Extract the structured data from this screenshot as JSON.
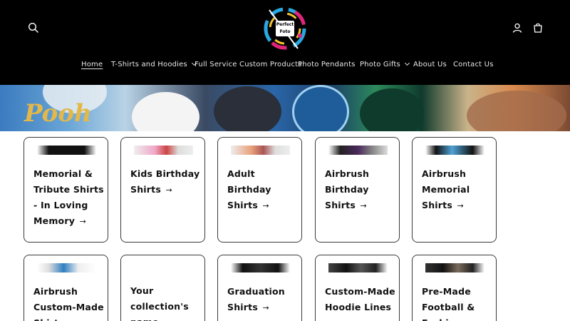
{
  "header": {
    "logo": {
      "line1": "Perfect",
      "line2": "Foto"
    },
    "icons": {
      "search": "search-icon",
      "account": "user-icon",
      "cart": "cart-icon"
    }
  },
  "nav": {
    "items": [
      {
        "label": "Home",
        "active": true,
        "dropdown": false
      },
      {
        "label": "T-Shirts and Hoodies",
        "active": false,
        "dropdown": true
      },
      {
        "label": "Full Service Custom Products",
        "active": false,
        "dropdown": false
      },
      {
        "label": "Photo Pendants",
        "active": false,
        "dropdown": false
      },
      {
        "label": "Photo Gifts",
        "active": false,
        "dropdown": true
      },
      {
        "label": "About Us",
        "active": false,
        "dropdown": false
      },
      {
        "label": "Contact Us",
        "active": false,
        "dropdown": false
      }
    ]
  },
  "banner": {
    "script_text": "Pooh"
  },
  "collections": {
    "row1": [
      {
        "title": "Memorial & Tribute Shirts - In Loving Memory",
        "arrow": "→"
      },
      {
        "title": "Kids Birthday Shirts",
        "arrow": "→"
      },
      {
        "title": "Adult Birthday Shirts",
        "arrow": "→"
      },
      {
        "title": "Airbrush Birthday Shirts",
        "arrow": "→"
      },
      {
        "title": "Airbrush Memorial Shirts",
        "arrow": "→"
      }
    ],
    "row2": [
      {
        "title": "Airbrush Custom-Made Shirts",
        "arrow": "→"
      },
      {
        "title": "Your collection's name",
        "arrow": "→"
      },
      {
        "title": "Graduation Shirts",
        "arrow": "→"
      },
      {
        "title": "Custom-Made Hoodie Lines",
        "arrow": "→"
      },
      {
        "title": "Pre-Made Football & Fashion",
        "arrow": "→"
      }
    ]
  },
  "colors": {
    "header_bg": "#000000",
    "card_border": "#3a3a3a",
    "text": "#121212"
  }
}
